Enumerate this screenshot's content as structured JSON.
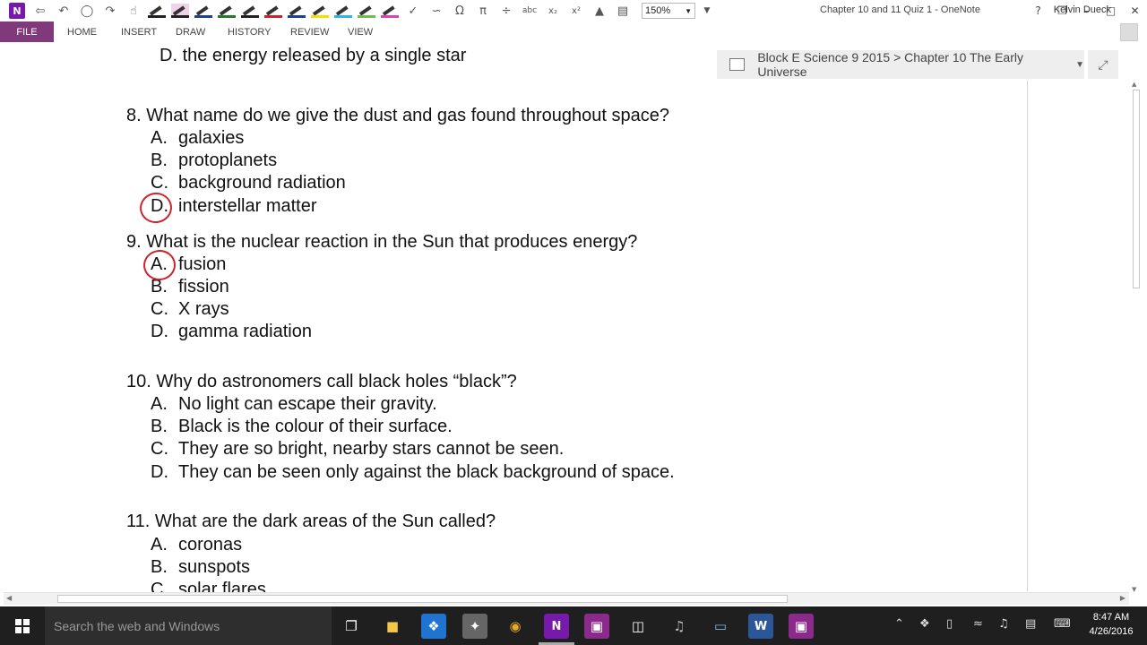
{
  "window": {
    "title": "Chapter 10 and 11 Quiz 1 - OneNote",
    "zoom": "150%",
    "controls": [
      "?",
      "❐",
      "–",
      "□",
      "✕"
    ]
  },
  "ribbon": {
    "tabs": [
      "FILE",
      "HOME",
      "INSERT",
      "DRAW",
      "HISTORY",
      "REVIEW",
      "VIEW"
    ],
    "user": "Kelvin Dueck",
    "pen_colors": [
      "#222222",
      "#222222",
      "#1f3f9a",
      "#1f7a2a",
      "#222222",
      "#d31f2a",
      "#1f3f9a",
      "#f2e000",
      "#2fb4e8",
      "#6cc04a",
      "#e040b0"
    ]
  },
  "notebook_path": {
    "text": "Block E Science 9 2015 > Chapter 10 The Early Universe"
  },
  "quiz": {
    "top_option": {
      "letter": "D.",
      "text": "the energy released by a single star"
    },
    "questions": [
      {
        "number": "8.",
        "text": "What name do we give the dust and gas found throughout space?",
        "options": [
          {
            "letter": "A.",
            "text": "galaxies"
          },
          {
            "letter": "B.",
            "text": "protoplanets"
          },
          {
            "letter": "C.",
            "text": "background radiation"
          },
          {
            "letter": "D.",
            "text": "interstellar matter"
          }
        ],
        "circled": "D"
      },
      {
        "number": "9.",
        "text": "What is the nuclear reaction in the Sun that produces energy?",
        "options": [
          {
            "letter": "A.",
            "text": "fusion"
          },
          {
            "letter": "B.",
            "text": "fission"
          },
          {
            "letter": "C.",
            "text": "X rays"
          },
          {
            "letter": "D.",
            "text": "gamma radiation"
          }
        ],
        "circled": "A"
      },
      {
        "number": "10.",
        "text": "Why do astronomers call black holes “black”?",
        "options": [
          {
            "letter": "A.",
            "text": "No light can escape their gravity."
          },
          {
            "letter": "B.",
            "text": "Black is the colour of their surface."
          },
          {
            "letter": "C.",
            "text": "They are so bright, nearby stars cannot be seen."
          },
          {
            "letter": "D.",
            "text": "They can be seen only against the black background of space."
          }
        ]
      },
      {
        "number": "11.",
        "text": "What are the dark areas of the Sun called?",
        "options": [
          {
            "letter": "A.",
            "text": "coronas"
          },
          {
            "letter": "B.",
            "text": "sunspots"
          },
          {
            "letter": "C.",
            "text": "solar flares"
          }
        ]
      }
    ],
    "annotation_color": "#d0222a"
  },
  "taskbar": {
    "search_placeholder": "Search the web and Windows",
    "apps": [
      "task-view",
      "file-explorer",
      "dropbox",
      "windows-store",
      "chrome",
      "onenote",
      "onenote-clip",
      "network",
      "itunes",
      "remote-desktop",
      "word",
      "onenote-alt"
    ],
    "time": "8:47 AM",
    "date": "4/26/2016"
  }
}
